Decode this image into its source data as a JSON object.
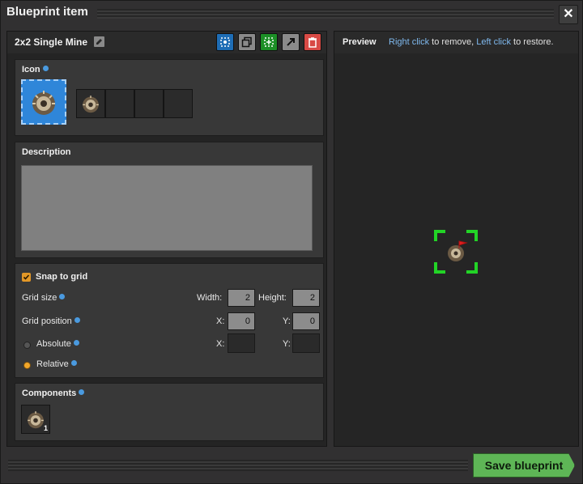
{
  "window": {
    "title": "Blueprint item",
    "close_icon": "close-icon"
  },
  "blueprint": {
    "name": "2x2 Single Mine",
    "toolbar_icons": [
      "select-area-icon",
      "copy-icon",
      "select-green-icon",
      "export-icon",
      "trash-icon"
    ]
  },
  "icon_section": {
    "title": "Icon",
    "main_icon": "mining-drill-icon",
    "slots": [
      "mining-drill-icon",
      "",
      "",
      ""
    ]
  },
  "description_section": {
    "title": "Description",
    "value": ""
  },
  "grid_section": {
    "snap_label": "Snap to grid",
    "snap_checked": true,
    "grid_size_label": "Grid size",
    "width_label": "Width:",
    "width_value": "2",
    "height_label": "Height:",
    "height_value": "2",
    "grid_position_label": "Grid position",
    "pos_x_label": "X:",
    "pos_x_value": "0",
    "pos_y_label": "Y:",
    "pos_y_value": "0",
    "absolute_label": "Absolute",
    "absolute_selected": false,
    "abs_x_label": "X:",
    "abs_x_value": "",
    "abs_y_label": "Y:",
    "abs_y_value": "",
    "relative_label": "Relative",
    "relative_selected": true
  },
  "components_section": {
    "title": "Components",
    "items": [
      {
        "icon": "mining-drill-icon",
        "count": "1"
      }
    ]
  },
  "preview": {
    "title": "Preview",
    "hint_a": "Right click",
    "hint_b": " to remove, ",
    "hint_c": "Left click",
    "hint_d": " to restore."
  },
  "footer": {
    "save_label": "Save blueprint"
  },
  "colors": {
    "accent_orange": "#e39827",
    "save_green": "#5eb656",
    "select_blue": "#1e6db5",
    "delete_red": "#d84a45",
    "preview_green": "#22d426"
  }
}
